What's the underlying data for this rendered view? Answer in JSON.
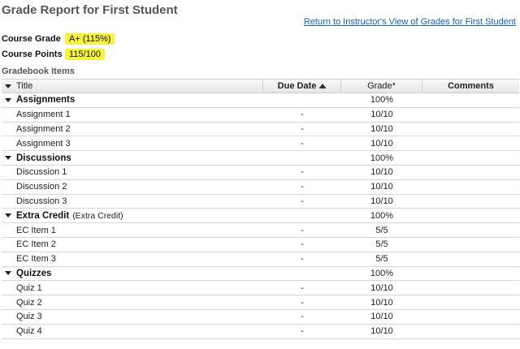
{
  "page": {
    "title": "Grade Report for First Student",
    "return_link": "Return to Instructor's View of Grades for First Student"
  },
  "summary": {
    "course_grade_label": "Course Grade",
    "course_grade_value": "A+ (115%)",
    "course_points_label": "Course Points",
    "course_points_value": "115/100"
  },
  "gradebook": {
    "heading": "Gradebook Items",
    "columns": {
      "title": "Title",
      "due_date": "Due Date",
      "grade": "Grade*",
      "comments": "Comments"
    },
    "categories": [
      {
        "name": "Assignments",
        "note": "",
        "grade": "100%",
        "items": [
          {
            "title": "Assignment 1",
            "due": "-",
            "grade": "10/10"
          },
          {
            "title": "Assignment 2",
            "due": "-",
            "grade": "10/10"
          },
          {
            "title": "Assignment 3",
            "due": "-",
            "grade": "10/10"
          }
        ]
      },
      {
        "name": "Discussions",
        "note": "",
        "grade": "100%",
        "items": [
          {
            "title": "Discussion 1",
            "due": "-",
            "grade": "10/10"
          },
          {
            "title": "Discussion 2",
            "due": "-",
            "grade": "10/10"
          },
          {
            "title": "Discussion 3",
            "due": "-",
            "grade": "10/10"
          }
        ]
      },
      {
        "name": "Extra Credit",
        "note": "(Extra Credit)",
        "grade": "100%",
        "items": [
          {
            "title": "EC Item 1",
            "due": "-",
            "grade": "5/5"
          },
          {
            "title": "EC Item 2",
            "due": "-",
            "grade": "5/5"
          },
          {
            "title": "EC Item 3",
            "due": "-",
            "grade": "5/5"
          }
        ]
      },
      {
        "name": "Quizzes",
        "note": "",
        "grade": "100%",
        "items": [
          {
            "title": "Quiz 1",
            "due": "-",
            "grade": "10/10"
          },
          {
            "title": "Quiz 2",
            "due": "-",
            "grade": "10/10"
          },
          {
            "title": "Quiz 3",
            "due": "-",
            "grade": "10/10"
          },
          {
            "title": "Quiz 4",
            "due": "-",
            "grade": "10/10"
          }
        ]
      }
    ]
  }
}
